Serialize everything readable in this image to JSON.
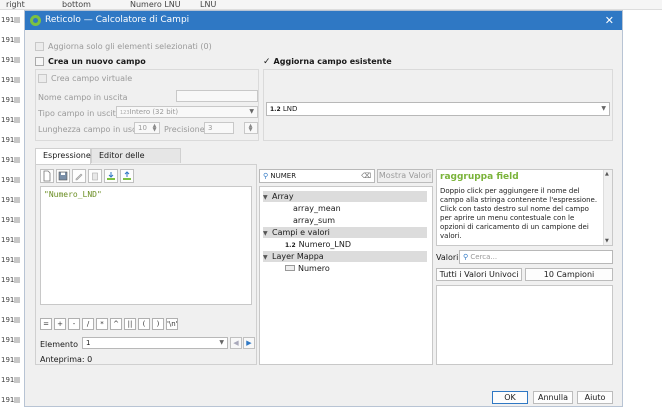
{
  "background": {
    "headers": [
      "right",
      "bottom",
      "Numero LNU",
      "LNU"
    ],
    "row_label": "191",
    "row_count": 20
  },
  "dialog": {
    "title": "Reticolo — Calcolatore di Campi",
    "only_selected_label": "Aggiorna solo gli elementi selezionati (0)",
    "create_new_label": "Crea un nuovo campo",
    "virtual_field_label": "Crea campo virtuale",
    "output_name_label": "Nome campo in uscita",
    "output_type_label": "Tipo campo in uscita",
    "output_type_value": "Intero (32 bit)",
    "output_type_prefix": "123",
    "output_length_label": "Lunghezza campo in uscita",
    "output_length_value": "10",
    "precision_label": "Precisione",
    "precision_value": "3",
    "update_existing_check": "✓",
    "update_existing_label": "Aggiorna campo esistente",
    "existing_field_prefix": "1.2",
    "existing_field_value": "LND"
  },
  "tabs": [
    {
      "label": "Espressione",
      "active": true
    },
    {
      "label": "Editor delle Funzioni",
      "active": false
    }
  ],
  "expression": {
    "text": "\"Numero_LND\"",
    "operators": [
      "=",
      "+",
      "-",
      "/",
      "*",
      "^",
      "||",
      "(",
      ")",
      "'\\n'"
    ],
    "element_label": "Elemento",
    "element_value": "1",
    "preview_label": "Anteprima:",
    "preview_value": "0"
  },
  "functions": {
    "search_value": "NUMER",
    "clear_icon": "⌫",
    "show_values_label": "Mostra Valori",
    "tree": [
      {
        "label": "Array",
        "level": 0,
        "expanded": true
      },
      {
        "label": "array_mean",
        "level": 2
      },
      {
        "label": "array_sum",
        "level": 2
      },
      {
        "label": "Campi e valori",
        "level": 0,
        "expanded": true
      },
      {
        "label": "Numero_LND",
        "level": 2,
        "prefix": "1.2"
      },
      {
        "label": "Layer Mappa",
        "level": 0,
        "expanded": true
      },
      {
        "label": "Numero",
        "level": 2,
        "icon": "polygon-layer-icon"
      }
    ]
  },
  "help": {
    "title": "raggruppa field",
    "text": "Doppio click per aggiungere il nome del campo alla stringa contenente l'espressione. Click con tasto destro sul nome del campo per aprire un menu contestuale con le opzioni di caricamento di un campione dei valori."
  },
  "values": {
    "label": "Valori",
    "search_placeholder": "Cerca...",
    "all_unique_label": "Tutti i Valori Univoci",
    "sample_label": "10 Campioni"
  },
  "buttons": {
    "ok": "OK",
    "cancel": "Annulla",
    "help": "Aiuto"
  }
}
